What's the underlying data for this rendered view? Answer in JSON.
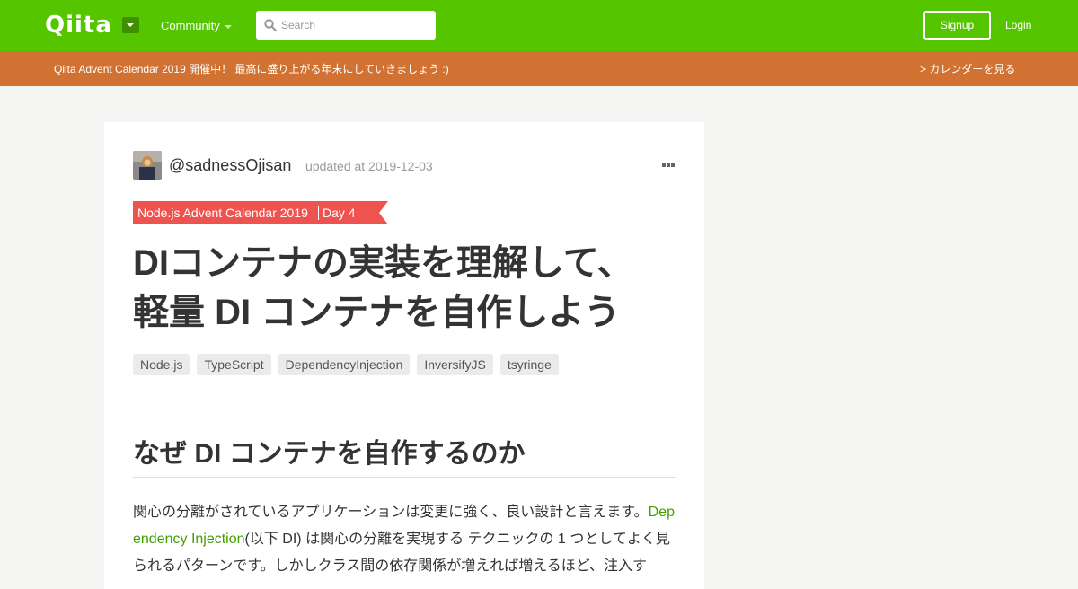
{
  "header": {
    "logo": "Qiita",
    "community_label": "Community",
    "search_placeholder": "Search",
    "signup_label": "Signup",
    "login_label": "Login"
  },
  "banner": {
    "text": "Qiita Advent Calendar 2019 開催中！ 最高に盛り上がる年末にしていきましょう :)",
    "link": "> カレンダーを見る"
  },
  "article": {
    "author": "@sadnessOjisan",
    "updated": "updated at 2019-12-03",
    "advent_calendar": "Node.js Advent Calendar 2019",
    "advent_day": "Day 4",
    "title_line1": "DIコンテナの実装を理解して、",
    "title_line2": "軽量 DI コンテナを自作しよう",
    "tags": [
      "Node.js",
      "TypeScript",
      "DependencyInjection",
      "InversifyJS",
      "tsyringe"
    ],
    "section_heading": "なぜ DI コンテナを自作するのか",
    "body_before_link": "関心の分離がされているアプリケーションは変更に強く、良い設計と言えます。",
    "body_link": "Dependency Injection",
    "body_after_link": "(以下 DI) は関心の分離を実現する テクニックの 1 つとしてよく見られるパターンです。しかしクラス間の依存関係が増えれば増えるほど、注入す"
  },
  "colors": {
    "brand_green": "#55c500",
    "banner_orange": "#d17232",
    "advent_red": "#ef5350",
    "link_green": "#3f9f00"
  }
}
